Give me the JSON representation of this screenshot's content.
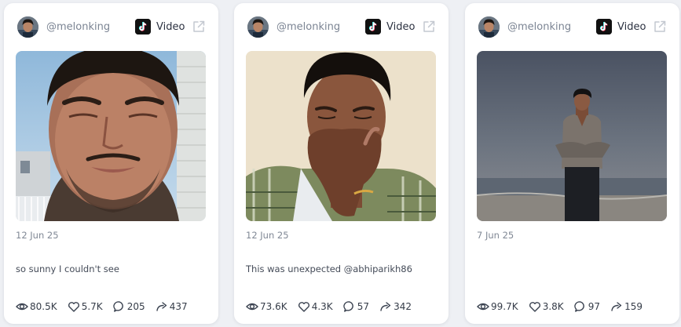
{
  "colors": {
    "page_background": "#eef0f4",
    "card_background": "#ffffff",
    "username": "#7b8493",
    "icon_stroke": "#3a4250"
  },
  "platform_icon": "tiktok-logo-icon",
  "cards": [
    {
      "username": "@melonking",
      "type_label": "Video",
      "date": "12 Jun 25",
      "caption": "so sunny I couldn't see",
      "stats": {
        "views": "80.5K",
        "likes": "5.7K",
        "comments": "205",
        "shares": "437"
      }
    },
    {
      "username": "@melonking",
      "type_label": "Video",
      "date": "12 Jun 25",
      "caption": "This was unexpected @abhiparikh86",
      "stats": {
        "views": "73.6K",
        "likes": "4.3K",
        "comments": "57",
        "shares": "342"
      }
    },
    {
      "username": "@melonking",
      "type_label": "Video",
      "date": "7 Jun 25",
      "caption": "",
      "stats": {
        "views": "99.7K",
        "likes": "3.8K",
        "comments": "97",
        "shares": "159"
      }
    }
  ]
}
